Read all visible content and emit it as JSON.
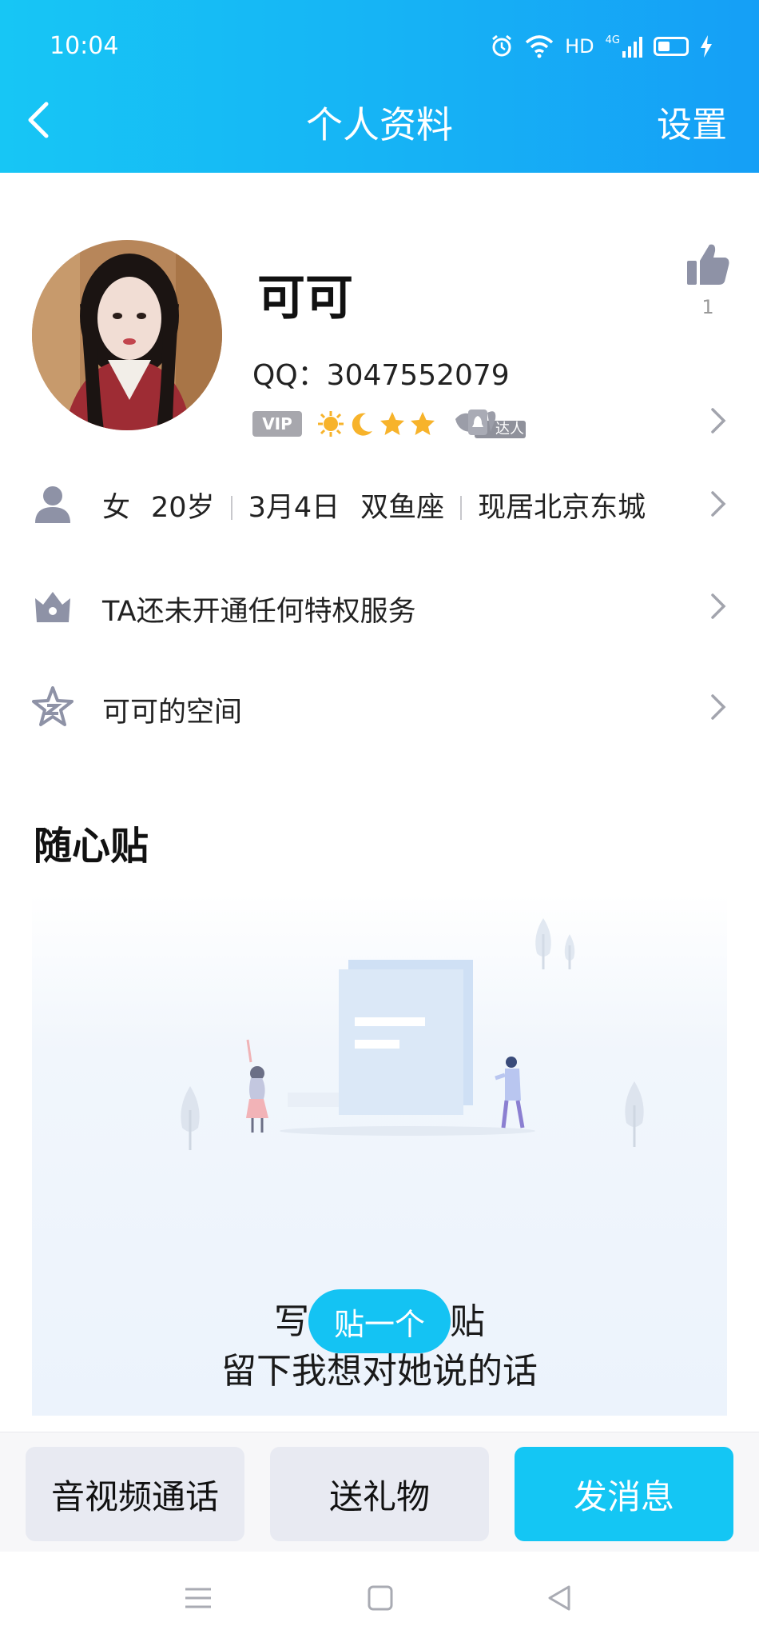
{
  "status_bar": {
    "time": "10:04",
    "hd": "HD",
    "network": "4G"
  },
  "header": {
    "title": "个人资料",
    "settings_label": "设置"
  },
  "profile": {
    "nickname": "可可",
    "qq_number": "QQ：3047552079",
    "vip_label": "VIP",
    "daren_label": "达人",
    "like_count": "1"
  },
  "info_rows": {
    "basic": {
      "gender": "女",
      "age": "20岁",
      "birthday": "3月4日",
      "zodiac": "双鱼座",
      "location": "现居北京东城"
    },
    "privilege": {
      "label": "TA还未开通任何特权服务"
    },
    "space": {
      "label": "可可的空间"
    }
  },
  "sticky_notes": {
    "section_title": "随心贴",
    "empty_line1": "写一张随心贴",
    "empty_line2": "留下我想对她说的话",
    "button_label": "贴一个"
  },
  "bottom_actions": {
    "call_label": "音视频通话",
    "gift_label": "送礼物",
    "message_label": "发消息"
  },
  "colors": {
    "header_gradient_start": "#17c6f5",
    "header_gradient_end": "#159ff6",
    "accent": "#14c6f4",
    "icon_grey": "#8e92a6"
  }
}
